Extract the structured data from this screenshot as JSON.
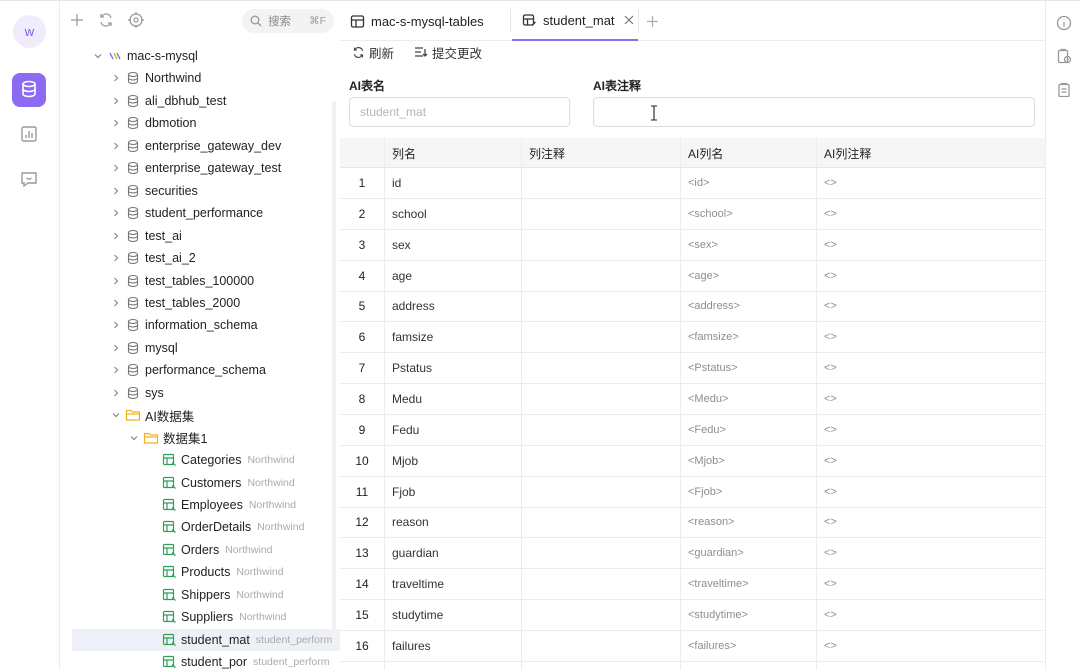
{
  "rail": {
    "avatar_letter": "w",
    "accent": "#8c6bf2"
  },
  "sidebar": {
    "search_placeholder": "搜索",
    "search_shortcut": "⌘F",
    "connection": "mac-s-mysql",
    "databases": [
      "Northwind",
      "ali_dbhub_test",
      "dbmotion",
      "enterprise_gateway_dev",
      "enterprise_gateway_test",
      "securities",
      "student_performance",
      "test_ai",
      "test_ai_2",
      "test_tables_100000",
      "test_tables_2000",
      "information_schema",
      "mysql",
      "performance_schema",
      "sys"
    ],
    "ai_folder": "AI数据集",
    "dataset_folder": "数据集1",
    "tables": [
      {
        "name": "Categories",
        "source": "Northwind"
      },
      {
        "name": "Customers",
        "source": "Northwind"
      },
      {
        "name": "Employees",
        "source": "Northwind"
      },
      {
        "name": "OrderDetails",
        "source": "Northwind"
      },
      {
        "name": "Orders",
        "source": "Northwind"
      },
      {
        "name": "Products",
        "source": "Northwind"
      },
      {
        "name": "Shippers",
        "source": "Northwind"
      },
      {
        "name": "Suppliers",
        "source": "Northwind"
      },
      {
        "name": "student_mat",
        "source": "student_perform"
      },
      {
        "name": "student_por",
        "source": "student_perform"
      }
    ]
  },
  "tabs": [
    {
      "label": "mac-s-mysql-tables",
      "active": false
    },
    {
      "label": "student_mat",
      "active": true
    }
  ],
  "toolbar": {
    "refresh_label": "刷新",
    "commit_label": "提交更改"
  },
  "form": {
    "ai_table_name_label": "AI表名",
    "ai_table_name_placeholder": "student_mat",
    "ai_table_comment_label": "AI表注释",
    "ai_table_comment_value": ""
  },
  "grid": {
    "columns": [
      "列名",
      "列注释",
      "AI列名",
      "AI列注释"
    ],
    "rows": [
      {
        "n": "1",
        "name": "id",
        "comment": "",
        "ai_name": "<id>",
        "ai_comment": "<>"
      },
      {
        "n": "2",
        "name": "school",
        "comment": "",
        "ai_name": "<school>",
        "ai_comment": "<>"
      },
      {
        "n": "3",
        "name": "sex",
        "comment": "",
        "ai_name": "<sex>",
        "ai_comment": "<>"
      },
      {
        "n": "4",
        "name": "age",
        "comment": "",
        "ai_name": "<age>",
        "ai_comment": "<>"
      },
      {
        "n": "5",
        "name": "address",
        "comment": "",
        "ai_name": "<address>",
        "ai_comment": "<>"
      },
      {
        "n": "6",
        "name": "famsize",
        "comment": "",
        "ai_name": "<famsize>",
        "ai_comment": "<>"
      },
      {
        "n": "7",
        "name": "Pstatus",
        "comment": "",
        "ai_name": "<Pstatus>",
        "ai_comment": "<>"
      },
      {
        "n": "8",
        "name": "Medu",
        "comment": "",
        "ai_name": "<Medu>",
        "ai_comment": "<>"
      },
      {
        "n": "9",
        "name": "Fedu",
        "comment": "",
        "ai_name": "<Fedu>",
        "ai_comment": "<>"
      },
      {
        "n": "10",
        "name": "Mjob",
        "comment": "",
        "ai_name": "<Mjob>",
        "ai_comment": "<>"
      },
      {
        "n": "11",
        "name": "Fjob",
        "comment": "",
        "ai_name": "<Fjob>",
        "ai_comment": "<>"
      },
      {
        "n": "12",
        "name": "reason",
        "comment": "",
        "ai_name": "<reason>",
        "ai_comment": "<>"
      },
      {
        "n": "13",
        "name": "guardian",
        "comment": "",
        "ai_name": "<guardian>",
        "ai_comment": "<>"
      },
      {
        "n": "14",
        "name": "traveltime",
        "comment": "",
        "ai_name": "<traveltime>",
        "ai_comment": "<>"
      },
      {
        "n": "15",
        "name": "studytime",
        "comment": "",
        "ai_name": "<studytime>",
        "ai_comment": "<>"
      },
      {
        "n": "16",
        "name": "failures",
        "comment": "",
        "ai_name": "<failures>",
        "ai_comment": "<>"
      }
    ]
  }
}
